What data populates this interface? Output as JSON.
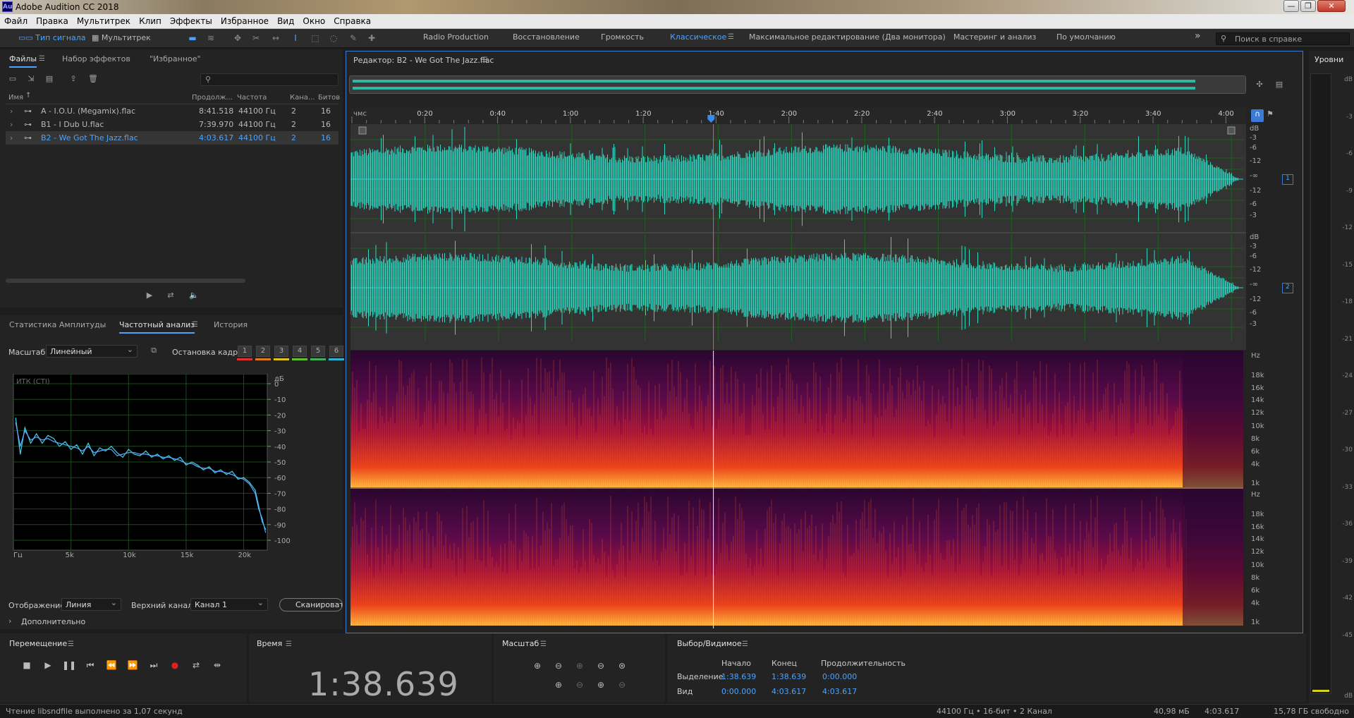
{
  "window": {
    "title": "Adobe Audition CC 2018",
    "logo": "Au",
    "buttons": [
      "—",
      "❐",
      "✕"
    ]
  },
  "menu": [
    "Файл",
    "Правка",
    "Мультитрек",
    "Клип",
    "Эффекты",
    "Избранное",
    "Вид",
    "Окно",
    "Справка"
  ],
  "toolbar": {
    "mode_waveform": "Тип сигнала",
    "mode_multitrack": "Мультитрек",
    "workspaces": [
      "Radio Production",
      "Восстановление",
      "Громкость",
      "Классическое",
      "Максимальное редактирование (Два монитора)",
      "Мастеринг и анализ",
      "По умолчанию"
    ],
    "active_workspace": "Классическое",
    "more": "»",
    "search_placeholder": "Поиск в справке"
  },
  "files_panel": {
    "tabs": [
      "Файлы",
      "Набор эффектов",
      "\"Избранное\""
    ],
    "search_placeholder": "",
    "columns": [
      "Имя",
      "Продолж...",
      "Частота",
      "Кана...",
      "Битов"
    ],
    "rows": [
      {
        "name": "A - I.O.U. (Megamix).flac",
        "duration": "8:41.518",
        "rate": "44100 Гц",
        "channels": "2",
        "bits": "16"
      },
      {
        "name": "B1 - I Dub U.flac",
        "duration": "7:39.970",
        "rate": "44100 Гц",
        "channels": "2",
        "bits": "16"
      },
      {
        "name": "B2 - We Got The Jazz.flac",
        "duration": "4:03.617",
        "rate": "44100 Гц",
        "channels": "2",
        "bits": "16"
      }
    ],
    "selected_row": 2
  },
  "freq_panel": {
    "tabs": [
      "Статистика Амплитуды",
      "Частотный анализ",
      "История"
    ],
    "scale_label": "Масштаб:",
    "scale_value": "Линейный",
    "freeze_label": "Остановка кадра:",
    "frames": [
      "1",
      "2",
      "3",
      "4",
      "5",
      "6"
    ],
    "frame_colors": [
      "#e03030",
      "#e07a20",
      "#e0c020",
      "#60c030",
      "#40b060",
      "#30b0d0"
    ],
    "display_label": "Отображение:",
    "display_value": "Линия",
    "channel_label": "Верхний канал:",
    "channel_value": "Канал 1",
    "scan_button": "Сканировать",
    "advanced": "Дополнительно"
  },
  "chart_data": {
    "type": "line",
    "title": "",
    "overlay_label": "ИТК (CTI)",
    "xlabel": "Гц",
    "ylabel": "дБ",
    "xlim": [
      0,
      22050
    ],
    "ylim": [
      -100,
      0
    ],
    "x_ticks": [
      "Гц",
      "5k",
      "10k",
      "15k",
      "20k"
    ],
    "y_ticks": [
      "дБ",
      "0",
      "-10",
      "-20",
      "-30",
      "-40",
      "-50",
      "-60",
      "-70",
      "-80",
      "-90",
      "-100"
    ],
    "grid": true,
    "series": [
      {
        "color": "#3ed0e8",
        "x": [
          200,
          600,
          1000,
          1500,
          2000,
          2500,
          3000,
          3500,
          4000,
          4500,
          5000,
          5500,
          6000,
          6500,
          7000,
          7500,
          8000,
          8500,
          9000,
          9500,
          10000,
          10500,
          11000,
          11500,
          12000,
          12500,
          13000,
          13500,
          14000,
          14500,
          15000,
          15500,
          16000,
          16500,
          17000,
          17500,
          18000,
          18500,
          19000,
          19500,
          20000,
          20500,
          21000,
          21300,
          21600,
          21900
        ],
        "y": [
          -22,
          -45,
          -28,
          -38,
          -32,
          -38,
          -33,
          -35,
          -40,
          -37,
          -42,
          -39,
          -45,
          -38,
          -46,
          -41,
          -43,
          -40,
          -44,
          -47,
          -42,
          -45,
          -46,
          -43,
          -47,
          -45,
          -48,
          -46,
          -49,
          -47,
          -52,
          -50,
          -52,
          -55,
          -53,
          -57,
          -55,
          -58,
          -56,
          -61,
          -60,
          -63,
          -68,
          -78,
          -88,
          -93
        ]
      },
      {
        "color": "#5aa8ff",
        "x": [
          200,
          600,
          1000,
          1500,
          2000,
          2500,
          3000,
          3500,
          4000,
          4500,
          5000,
          5500,
          6000,
          6500,
          7000,
          7500,
          8000,
          8500,
          9000,
          9500,
          10000,
          10500,
          11000,
          11500,
          12000,
          12500,
          13000,
          13500,
          14000,
          14500,
          15000,
          15500,
          16000,
          16500,
          17000,
          17500,
          18000,
          18500,
          19000,
          19500,
          20000,
          20500,
          21000,
          21300,
          21600,
          21900
        ],
        "y": [
          -25,
          -40,
          -30,
          -36,
          -34,
          -36,
          -35,
          -37,
          -38,
          -39,
          -40,
          -41,
          -43,
          -40,
          -44,
          -43,
          -42,
          -42,
          -46,
          -45,
          -44,
          -44,
          -45,
          -45,
          -46,
          -46,
          -47,
          -47,
          -48,
          -49,
          -51,
          -51,
          -53,
          -54,
          -54,
          -56,
          -56,
          -57,
          -58,
          -60,
          -61,
          -64,
          -70,
          -80,
          -86,
          -95
        ]
      }
    ]
  },
  "editor": {
    "title": "Редактор: B2 - We Got The Jazz.flac",
    "time_unit": "чмс",
    "ruler": [
      "0:20",
      "0:40",
      "1:00",
      "1:20",
      "1:40",
      "2:00",
      "2:20",
      "2:40",
      "3:00",
      "3:20",
      "3:40",
      "4:00"
    ],
    "db_scale_upper": [
      "dB",
      "-3",
      "-6",
      "-12",
      "-∞",
      "-12",
      "-6",
      "-3"
    ],
    "db_scale_lower": [
      "dB",
      "-3",
      "-6",
      "-12",
      "-∞",
      "-12",
      "-6",
      "-3"
    ],
    "channel_badges": [
      "1",
      "2"
    ],
    "hz_scale": [
      "Hz",
      "18k",
      "16k",
      "14k",
      "12k",
      "10k",
      "8k",
      "6k",
      "4k",
      "1k"
    ],
    "waveform_color": "#2fd6c0",
    "playhead_color": "#e06050"
  },
  "transport": {
    "title": "Перемещение"
  },
  "time_panel": {
    "title": "Время",
    "current_time": "1:38.639"
  },
  "zoom_panel": {
    "title": "Масштаб"
  },
  "selection": {
    "title": "Выбор/Видимое",
    "col_start": "Начало",
    "col_end": "Конец",
    "col_duration": "Продолжительность",
    "row_selection": "Выделение",
    "row_view": "Вид",
    "sel_start": "1:38.639",
    "sel_end": "1:38.639",
    "sel_dur": "0:00.000",
    "view_start": "0:00.000",
    "view_end": "4:03.617",
    "view_dur": "4:03.617"
  },
  "levels": {
    "title": "Уровни",
    "scale": [
      "dB",
      "-3",
      "-6",
      "-9",
      "-12",
      "-15",
      "-18",
      "-21",
      "-24",
      "-27",
      "-30",
      "-33",
      "-36",
      "-39",
      "-42",
      "-45",
      "dB"
    ]
  },
  "status": {
    "message": "Чтение libsndfile выполнено за 1,07 секунд",
    "format": "44100 Гц • 16-бит • 2 Канал",
    "size": "40,98 мБ",
    "duration": "4:03.617",
    "free": "15,78 ГБ свободно"
  }
}
